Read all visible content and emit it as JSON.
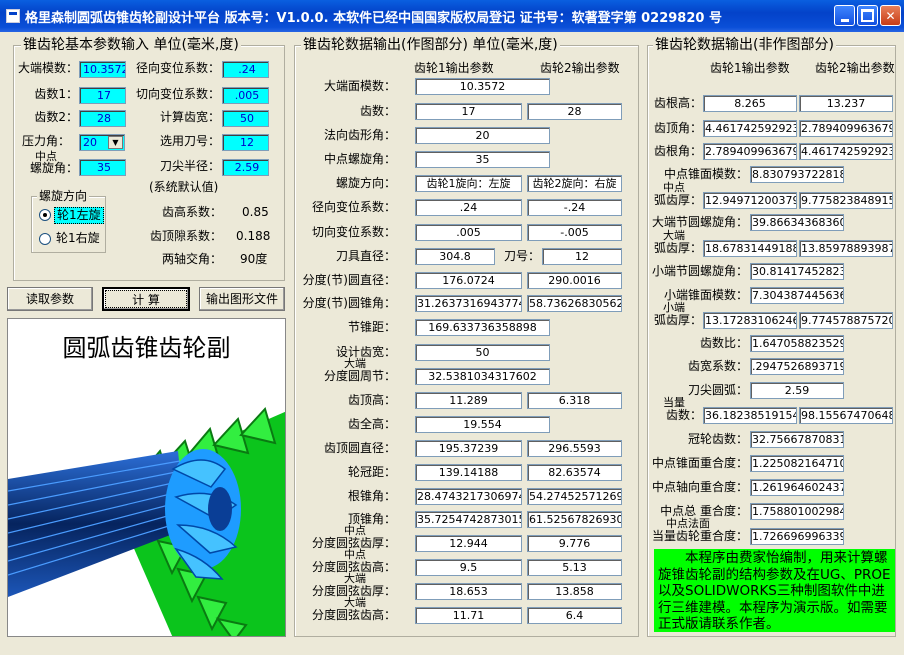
{
  "window": {
    "title": "格里森制圆弧齿锥齿轮副设计平台  版本号：V1.0.0.   本软件已经中国国家版权局登记   证书号：软著登字第 0229820 号"
  },
  "input": {
    "legend": "锥齿轮基本参数输入 单位(毫米,度)",
    "fields": {
      "module": {
        "label": "大端模数：",
        "value": "10.3572"
      },
      "z1": {
        "label": "齿数1：",
        "value": "17"
      },
      "z2": {
        "label": "齿数2：",
        "value": "28"
      },
      "pressure": {
        "label": "压力角：",
        "value": "20"
      },
      "helix_l1": {
        "label": "中点"
      },
      "helix_l2": {
        "label": "螺旋角："
      },
      "helix": {
        "value": "35"
      },
      "radial_shift": {
        "label": "径向变位系数：",
        "value": ".24"
      },
      "tang_shift": {
        "label": "切向变位系数：",
        "value": ".005"
      },
      "calc_width": {
        "label": "计算齿宽：",
        "value": "50"
      },
      "tool_no": {
        "label": "选用刀号：",
        "value": "12"
      },
      "tip_radius": {
        "label": "刀尖半径：",
        "value": "2.59"
      }
    },
    "hand": {
      "legend": "螺旋方向",
      "left": "轮1左旋",
      "right": "轮1右旋"
    },
    "defaults": {
      "title": "(系统默认值)",
      "addendum_label": "齿高系数：",
      "addendum": "0.85",
      "clearance_label": "齿顶隙系数：",
      "clearance": "0.188",
      "shaft_label": "两轴交角：",
      "shaft": "90度"
    }
  },
  "buttons": {
    "read": "读取参数",
    "calc": "计  算",
    "export": "输出图形文件"
  },
  "preview": {
    "title": "圆弧齿锥齿轮副"
  },
  "drawing": {
    "legend": "锥齿轮数据输出(作图部分) 单位(毫米,度)",
    "col1": "齿轮1输出参数",
    "col2": "齿轮2输出参数",
    "rows": [
      {
        "l": "大端面模数：",
        "a": "10.3572"
      },
      {
        "l": "齿数：",
        "a": "17",
        "b": "28"
      },
      {
        "l": "法向齿形角：",
        "a": "20"
      },
      {
        "l": "中点螺旋角：",
        "a": "35"
      },
      {
        "l": "螺旋方向：",
        "a": "齿轮1旋向：左旋",
        "b": "齿轮2旋向：右旋"
      },
      {
        "l": "径向变位系数：",
        "a": ".24",
        "b": "-.24"
      },
      {
        "l": "切向变位系数：",
        "a": ".005",
        "b": "-.005"
      },
      {
        "l": "刀具直径：",
        "a": "304.8",
        "c": "刀号：",
        "b": "12"
      },
      {
        "l": "分度(节)圆直径：",
        "a": "176.0724",
        "b": "290.0016"
      },
      {
        "l": "分度(节)圆锥角：",
        "a": "31.26373169437748",
        "b": "58.73626830562252"
      },
      {
        "l": "节锥距：",
        "a": "169.633736358898"
      },
      {
        "l": "设计齿宽：",
        "a": "50"
      },
      {
        "l1": "大端",
        "l": "分度圆周节：",
        "a": "32.5381034317602"
      },
      {
        "l": "齿顶高：",
        "a": "11.289",
        "b": "6.318"
      },
      {
        "l": "齿全高：",
        "a": "19.554"
      },
      {
        "l": "齿顶圆直径：",
        "a": "195.37239",
        "b": "296.5593"
      },
      {
        "l": "轮冠距：",
        "a": "139.14188",
        "b": "82.63574"
      },
      {
        "l": "根锥角：",
        "a": "28.47432173069748",
        "b": "54.27452571269925"
      },
      {
        "l": "顶锥角：",
        "a": "35.72547428730152",
        "b": "61.52567826930252"
      },
      {
        "l1": "中点",
        "l": "分度圆弦齿厚：",
        "a": "12.944",
        "b": "9.776"
      },
      {
        "l1": "中点",
        "l": "分度圆弦齿高：",
        "a": "9.5",
        "b": "5.13"
      },
      {
        "l1": "大端",
        "l": "分度圆弦齿厚：",
        "a": "18.653",
        "b": "13.858"
      },
      {
        "l1": "大端",
        "l": "分度圆弦齿高：",
        "a": "11.71",
        "b": "6.4"
      }
    ]
  },
  "nondrawing": {
    "legend": "锥齿轮数据输出(非作图部分)",
    "col1": "齿轮1输出参数",
    "col2": "齿轮2输出参数",
    "rows": [
      {
        "l": "齿根高：",
        "a": "8.265",
        "b": "13.237",
        "style": "c"
      },
      {
        "l": "齿顶角：",
        "a": "4.461742592923583",
        "b": "2.789409963679612"
      },
      {
        "l": "齿根角：",
        "a": "2.789409963679612",
        "b": "4.461742592923583"
      },
      {
        "l": "中点锥面模数：",
        "a": "8.830793722818394"
      },
      {
        "l1": "中点",
        "l": "弧齿厚：",
        "a": "12.94971200379220",
        "b": "9.775823848915423"
      },
      {
        "l": "大端节圆螺旋角：",
        "a": "39.86634368360628"
      },
      {
        "l1": "大端",
        "l": "弧齿厚：",
        "a": "18.67831449188250",
        "b": "13.85978893987700"
      },
      {
        "l": "小端节圆螺旋角：",
        "a": "30.81417452823899"
      },
      {
        "l": "小端锥面模数：",
        "a": "7.304387445636690"
      },
      {
        "l1": "小端",
        "l": "弧齿厚：",
        "a": "13.17283106246480",
        "b": "9.774578875720890"
      },
      {
        "l": "齿数比：",
        "a": "1.6470588235294"
      },
      {
        "l": "齿宽系数：",
        "a": ".294752689371965"
      },
      {
        "l": "刀尖圆弧：",
        "a": "2.59",
        "style": "c"
      },
      {
        "l1": "当量",
        "l": "齿数：",
        "a": "36.18238519154700",
        "b": "98.15567470648200"
      },
      {
        "l": "冠轮齿数：",
        "a": "32.75667870831800"
      },
      {
        "l": "中点锥面重合度：",
        "a": "1.225082164710300"
      },
      {
        "l": "中点轴向重合度：",
        "a": "1.261964602437900"
      },
      {
        "l": "中点总  重合度：",
        "a": "1.758801002984000"
      },
      {
        "l1": "中点法面",
        "l": "当量齿轮重合度：",
        "a": "1.726696996339700"
      }
    ],
    "note": "本程序由费家怡编制，用来计算螺旋锥齿轮副的结构参数及在UG、PROE以及SOLIDWORKS三种制图软件中进行三维建模。本程序为演示版。如需要正式版请联系作者。"
  },
  "colors": {
    "title": "#0342c9",
    "input": "#00ffff",
    "note": "#00ff00",
    "gear": "#00dd22",
    "pinion": "#1a9bff"
  }
}
